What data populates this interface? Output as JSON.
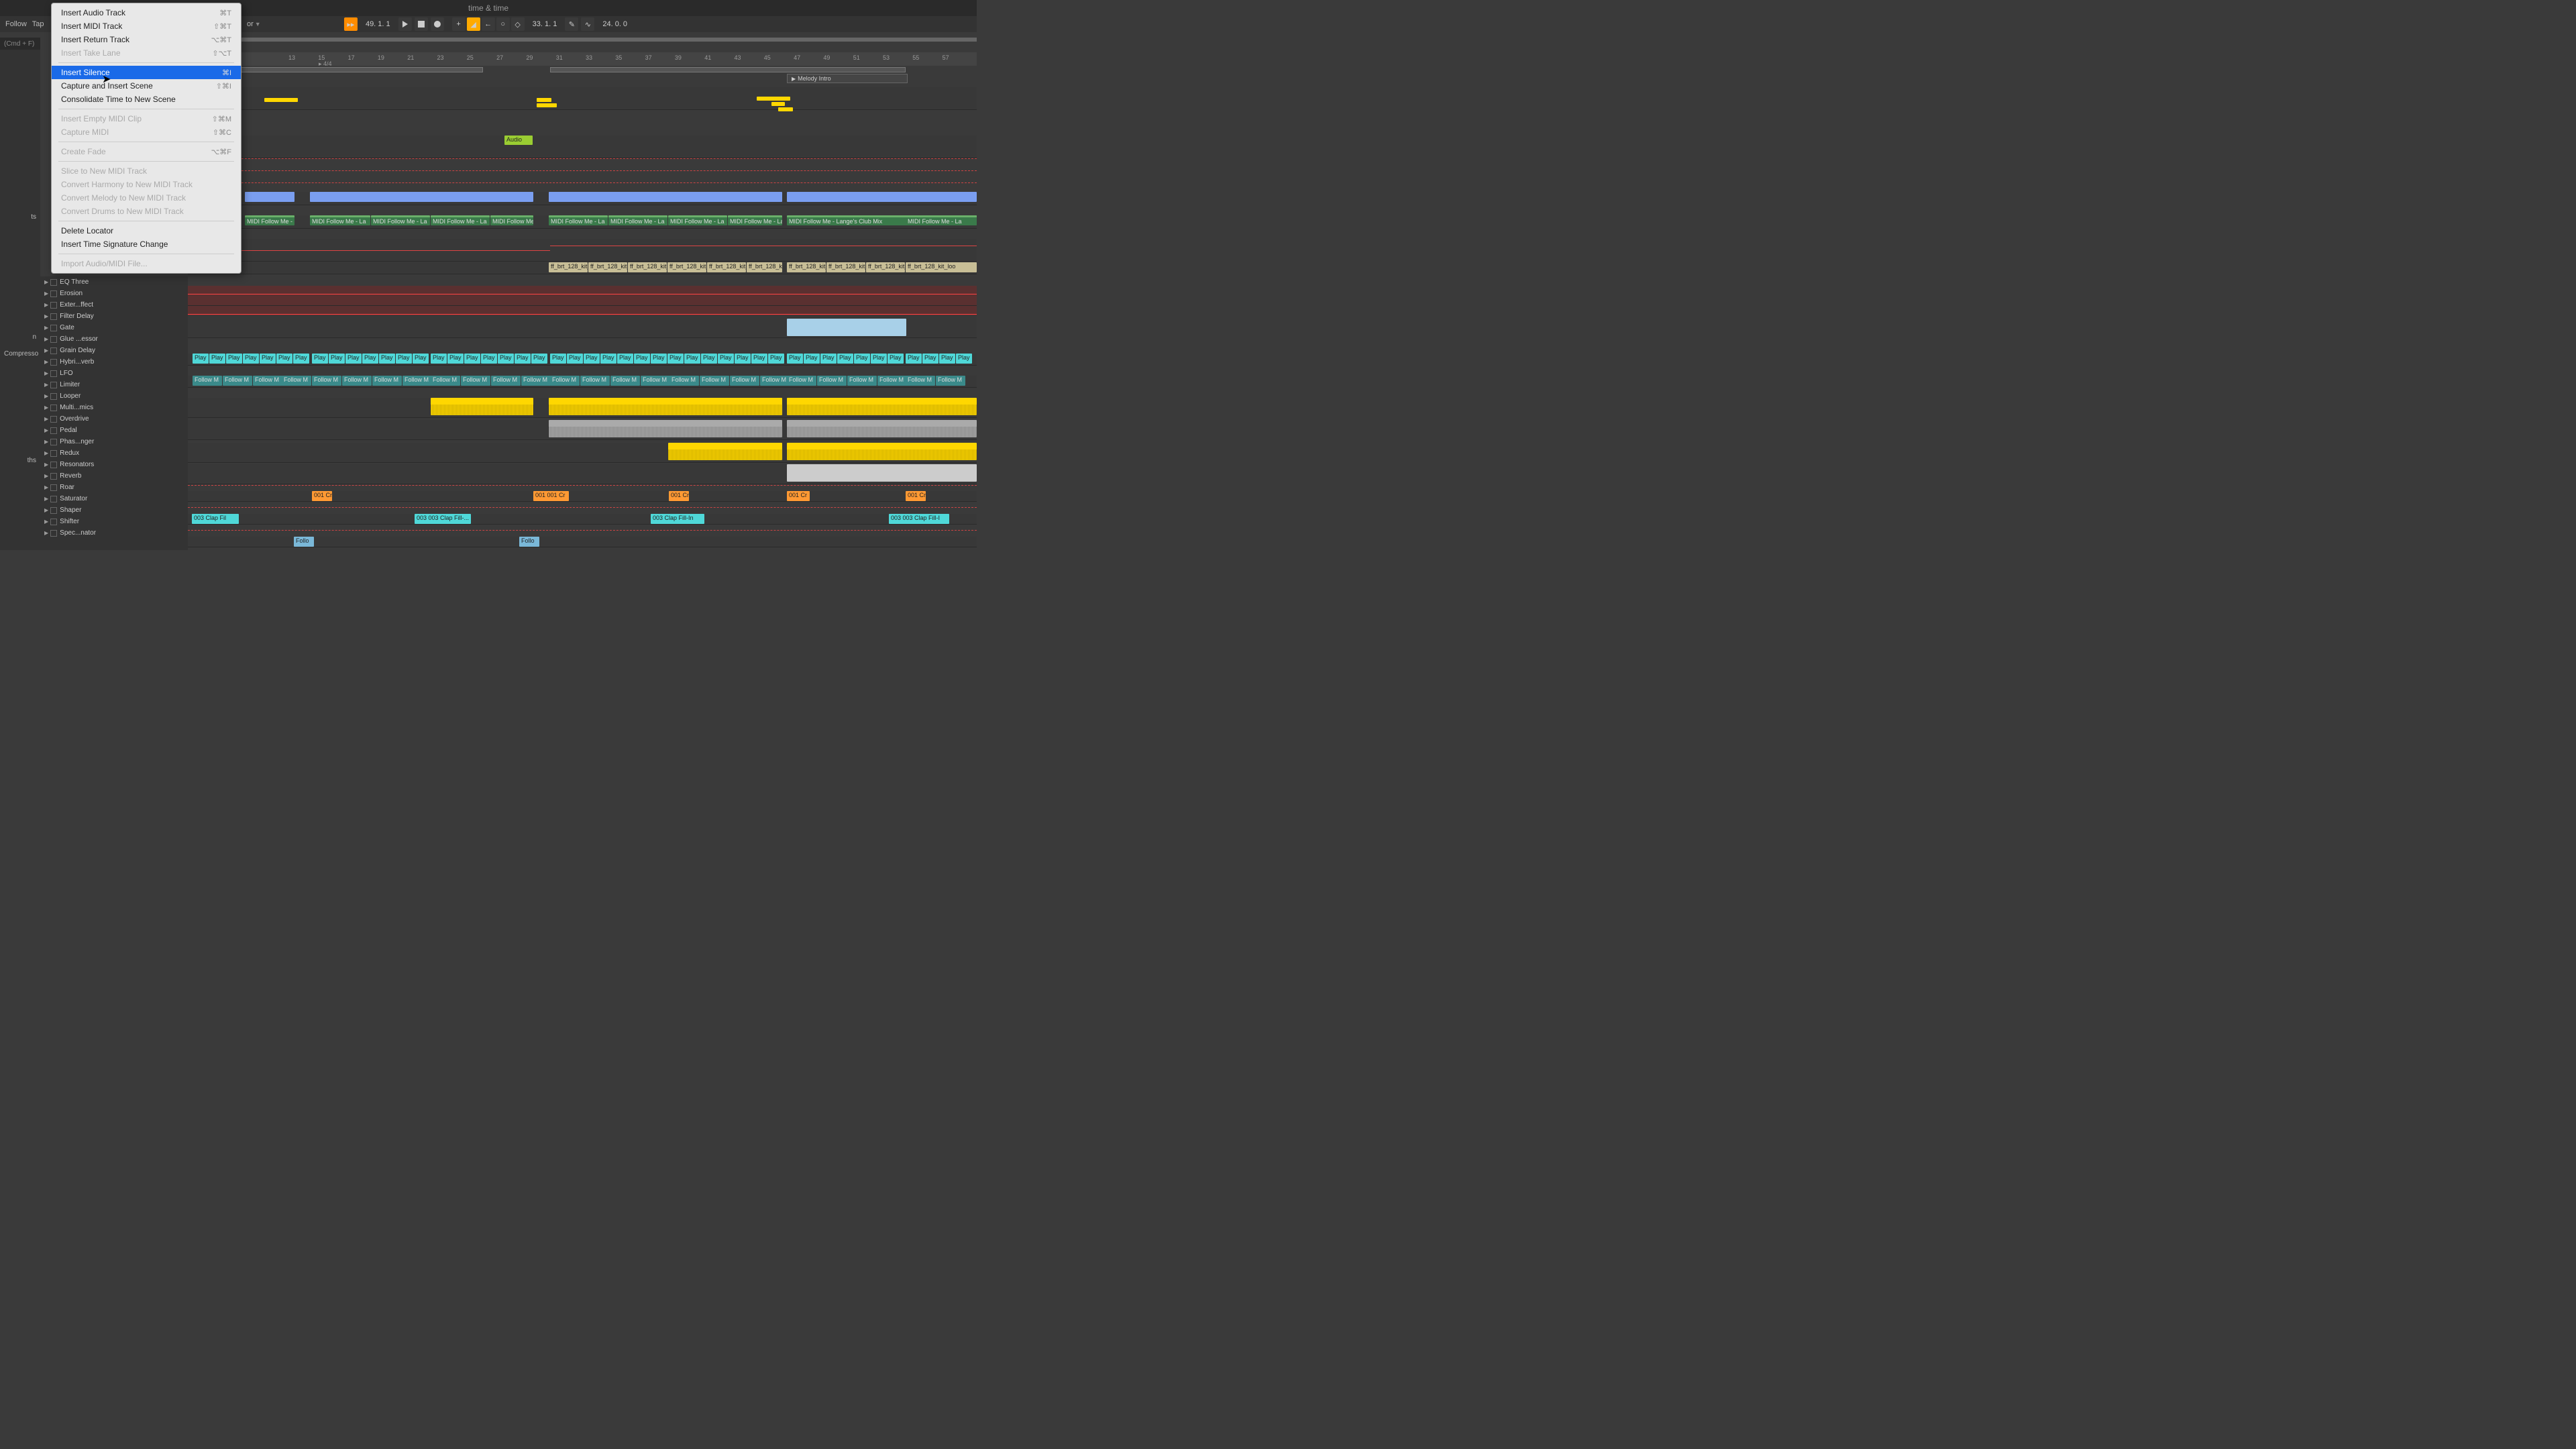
{
  "title": "time & time",
  "toolbar": {
    "follow": "Follow",
    "tap": "Tap",
    "key_dropdown": "or",
    "pos1": "49. 1. 1",
    "pos2": "33. 1. 1",
    "tempo": "24. 0. 0"
  },
  "search": {
    "placeholder": "(Cmd + F)"
  },
  "sidebar": {
    "items": [
      "ts",
      "n",
      "Compresso",
      "ths"
    ]
  },
  "ruler": {
    "marks": [
      "13",
      "15",
      "17",
      "19",
      "21",
      "23",
      "25",
      "27",
      "29",
      "31",
      "33",
      "35",
      "37",
      "39",
      "41",
      "43",
      "45",
      "47",
      "49",
      "51",
      "53",
      "55",
      "57"
    ],
    "time_sig": "4/4"
  },
  "locator": {
    "label": "Melody Intro"
  },
  "browser": {
    "items": [
      "EQ Three",
      "Erosion",
      "Exter...ffect",
      "Filter Delay",
      "Gate",
      "Glue ...essor",
      "Grain Delay",
      "Hybri...verb",
      "LFO",
      "Limiter",
      "Looper",
      "Multi...mics",
      "Overdrive",
      "Pedal",
      "Phas...nger",
      "Redux",
      "Resonators",
      "Reverb",
      "Roar",
      "Saturator",
      "Shaper",
      "Shifter",
      "Spec...nator"
    ]
  },
  "menu": {
    "items": [
      {
        "label": "Insert Audio Track",
        "shortcut": "⌘T",
        "enabled": true
      },
      {
        "label": "Insert MIDI Track",
        "shortcut": "⇧⌘T",
        "enabled": true
      },
      {
        "label": "Insert Return Track",
        "shortcut": "⌥⌘T",
        "enabled": true
      },
      {
        "label": "Insert Take Lane",
        "shortcut": "⇧⌥T",
        "enabled": false
      },
      {
        "type": "sep"
      },
      {
        "label": "Insert Silence",
        "shortcut": "⌘I",
        "enabled": true,
        "highlighted": true
      },
      {
        "label": "Capture and Insert Scene",
        "shortcut": "⇧⌘I",
        "enabled": true
      },
      {
        "label": "Consolidate Time to New Scene",
        "shortcut": "",
        "enabled": true
      },
      {
        "type": "sep"
      },
      {
        "label": "Insert Empty MIDI Clip",
        "shortcut": "⇧⌘M",
        "enabled": false
      },
      {
        "label": "Capture MIDI",
        "shortcut": "⇧⌘C",
        "enabled": false
      },
      {
        "type": "sep"
      },
      {
        "label": "Create Fade",
        "shortcut": "⌥⌘F",
        "enabled": false
      },
      {
        "type": "sep"
      },
      {
        "label": "Slice to New MIDI Track",
        "shortcut": "",
        "enabled": false
      },
      {
        "label": "Convert Harmony to New MIDI Track",
        "shortcut": "",
        "enabled": false
      },
      {
        "label": "Convert Melody to New MIDI Track",
        "shortcut": "",
        "enabled": false
      },
      {
        "label": "Convert Drums to New MIDI Track",
        "shortcut": "",
        "enabled": false
      },
      {
        "type": "sep"
      },
      {
        "label": "Delete Locator",
        "shortcut": "",
        "enabled": true
      },
      {
        "label": "Insert Time Signature Change",
        "shortcut": "",
        "enabled": true
      },
      {
        "type": "sep"
      },
      {
        "label": "Import Audio/MIDI File...",
        "shortcut": "",
        "enabled": false
      }
    ]
  },
  "clips": {
    "audio_label": "Audio",
    "midi_follow": "MIDI Follow Me - La",
    "midi_follow_long": "MIDI Follow Me - Lange's Club Mix",
    "kit_loop": "ff_brt_128_kit_loo",
    "play": "Play",
    "follow_m": "Follow M",
    "crash": "001 Cr",
    "crash2": "001 001 Cr",
    "clap_fill": "003 Clap Fil",
    "clap_fill2": "003 003 Clap Fill-...",
    "clap_fill3": "003 003 Clap Fil...",
    "clap_fill4": "003 Clap Fill-In",
    "clap_fill5": "003 003 Clap Fill-I",
    "follo": "Follo"
  }
}
